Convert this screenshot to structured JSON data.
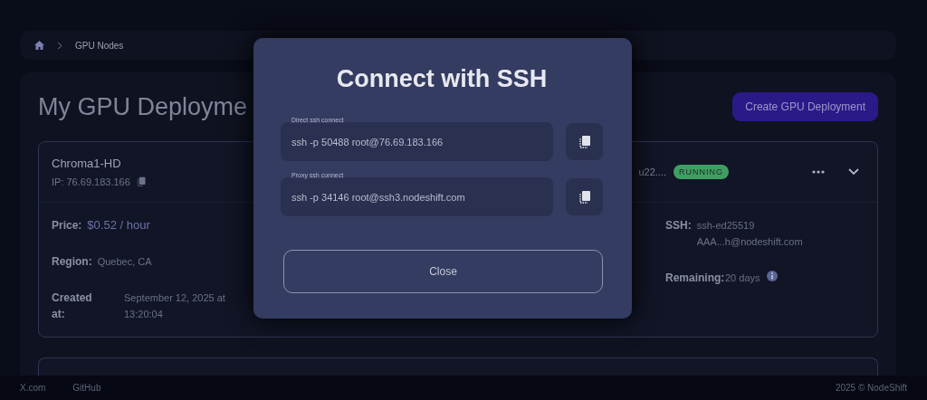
{
  "breadcrumb": {
    "items": [
      "GPU Nodes"
    ]
  },
  "page_title": "My GPU Deployme",
  "create_button": "Create GPU Deployment",
  "deployment": {
    "name": "Chroma1-HD",
    "ip": "IP: 76.69.183.166",
    "image": "u22....",
    "status": {
      "label": "RUNNING",
      "color": "#3f9f63"
    },
    "expanded": true,
    "details_left": [
      {
        "label": "Price:",
        "value": "$0.52 / hour",
        "kind": "accent"
      },
      {
        "label": "Region:",
        "value": "Quebec, CA",
        "kind": "plain"
      },
      {
        "label": "Created at:",
        "value": "September 12, 2025 at 13:20:04",
        "kind": "plain"
      }
    ],
    "details_right": [
      {
        "label": "SSH:",
        "value": "ssh-ed25519 AAA...h@nodeshift.com",
        "kind": "plain"
      },
      {
        "label": "Remaining:",
        "value": "20 days",
        "kind": "info"
      }
    ]
  },
  "modal": {
    "title": "Connect with SSH",
    "fields": [
      {
        "label": "Direct ssh connect",
        "value": "ssh -p 50488 root@76.69.183.166"
      },
      {
        "label": "Proxy ssh connect",
        "value": "ssh -p 34146 root@ssh3.nodeshift.com"
      }
    ],
    "close_button": "Close"
  },
  "footer": {
    "links": [
      "X.com",
      "GitHub"
    ],
    "copyright": "2025 © NodeShift"
  }
}
